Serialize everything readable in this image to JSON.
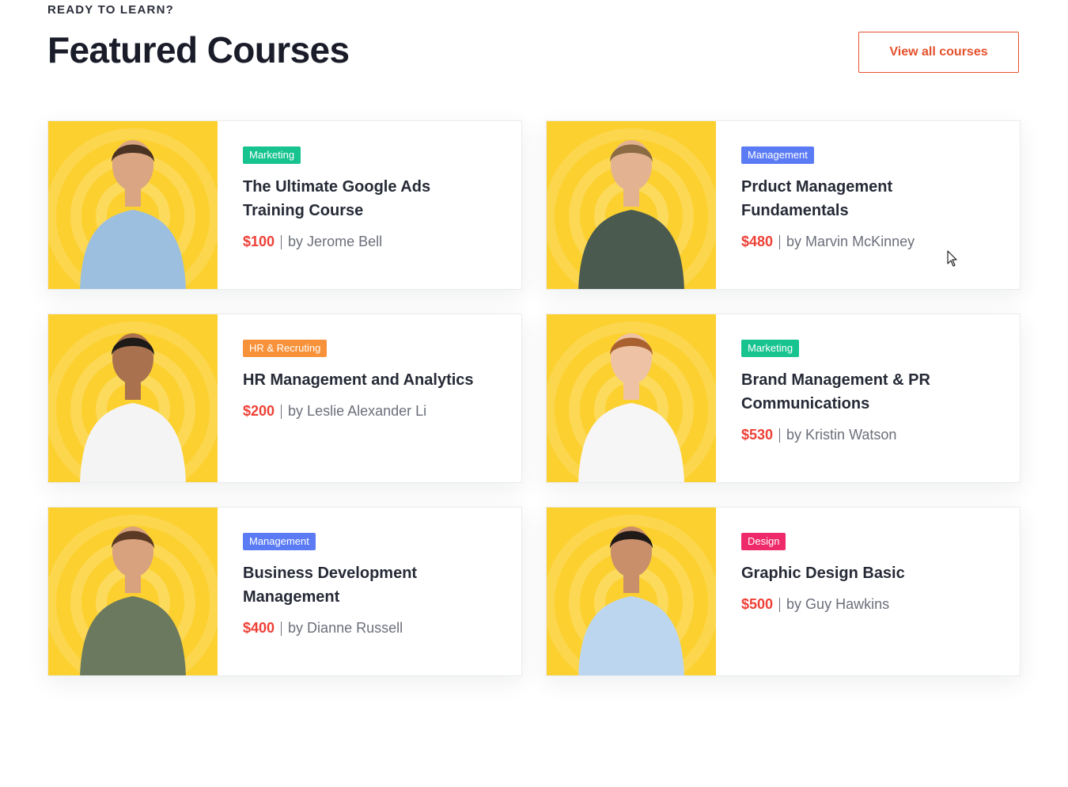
{
  "header": {
    "eyebrow": "READY TO LEARN?",
    "title": "Featured Courses",
    "view_all_label": "View all courses"
  },
  "colors": {
    "accent": "#e5502c",
    "price": "#ee4036",
    "photo_bg": "#fcd02f"
  },
  "courses": [
    {
      "tag": "Marketing",
      "tag_color": "#17c38f",
      "title": "The Ultimate Google Ads Training Course",
      "price": "$100",
      "author": "by Jerome Bell",
      "shirt": "#9dbfdf",
      "hair": "#4a3322",
      "skin": "#d9a582"
    },
    {
      "tag": "Management",
      "tag_color": "#5b7bf5",
      "title": "Prduct Management Fundamentals",
      "price": "$480",
      "author": "by Marvin McKinney",
      "shirt": "#4a5a4f",
      "hair": "#8a6b44",
      "skin": "#e3b391"
    },
    {
      "tag": "HR & Recruting",
      "tag_color": "#f7923a",
      "title": "HR  Management and Analytics",
      "price": "$200",
      "author": "by Leslie Alexander Li",
      "shirt": "#f4f4f4",
      "hair": "#1d1a18",
      "skin": "#a9714d"
    },
    {
      "tag": "Marketing",
      "tag_color": "#17c38f",
      "title": "Brand Management & PR Communications",
      "price": "$530",
      "author": "by Kristin Watson",
      "shirt": "#f6f6f6",
      "hair": "#a8612f",
      "skin": "#eec2a4"
    },
    {
      "tag": "Management",
      "tag_color": "#5b7bf5",
      "title": "Business Development Management",
      "price": "$400",
      "author": "by Dianne Russell",
      "shirt": "#6b7a5f",
      "hair": "#5a3a24",
      "skin": "#d9a27e"
    },
    {
      "tag": "Design",
      "tag_color": "#ee2a6b",
      "title": "Graphic Design Basic",
      "price": "$500",
      "author": "by Guy Hawkins",
      "shirt": "#bcd6f0",
      "hair": "#1f1a17",
      "skin": "#c98f6b"
    }
  ]
}
